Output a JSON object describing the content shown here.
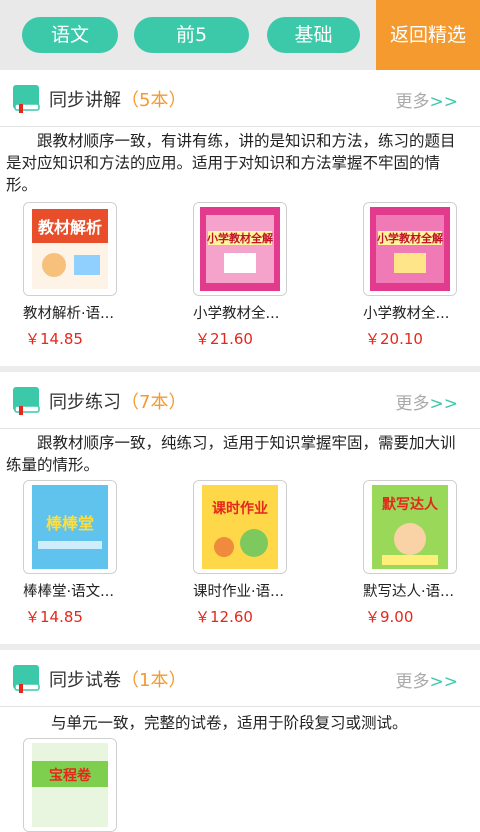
{
  "filters": {
    "subject": "语文",
    "rank": "前5",
    "level": "基础",
    "back": "返回精选"
  },
  "colors": {
    "accent": "#3cc9a9",
    "orange": "#f59a2f",
    "price": "#e4281c"
  },
  "sections": [
    {
      "title": "同步讲解",
      "count": "（5本）",
      "more": "更多",
      "more_arrow": ">>",
      "desc": "跟教材顺序一致，有讲有练，讲的是知识和方法，练习的题目是对应知识和方法的应用。适用于对知识和方法掌握不牢固的情形。",
      "books": [
        {
          "name": "教材解析·语...",
          "price": "￥14.85",
          "cover_text": "教材解析"
        },
        {
          "name": "小学教材全...",
          "price": "￥21.60",
          "cover_text": "小学教材全解"
        },
        {
          "name": "小学教材全...",
          "price": "￥20.10",
          "cover_text": "小学教材全解"
        }
      ]
    },
    {
      "title": "同步练习",
      "count": "（7本）",
      "more": "更多",
      "more_arrow": ">>",
      "desc": "跟教材顺序一致，纯练习，适用于知识掌握牢固，需要加大训练量的情形。",
      "books": [
        {
          "name": "棒棒堂·语文...",
          "price": "￥14.85",
          "cover_text": "棒棒堂"
        },
        {
          "name": "课时作业·语...",
          "price": "￥12.60",
          "cover_text": "课时作业"
        },
        {
          "name": "默写达人·语...",
          "price": "￥9.00",
          "cover_text": "默写达人"
        }
      ]
    },
    {
      "title": "同步试卷",
      "count": "（1本）",
      "more": "更多",
      "more_arrow": ">>",
      "desc": "与单元一致，完整的试卷，适用于阶段复习或测试。",
      "books": [
        {
          "name": "",
          "price": "",
          "cover_text": "宝程卷"
        }
      ]
    }
  ]
}
